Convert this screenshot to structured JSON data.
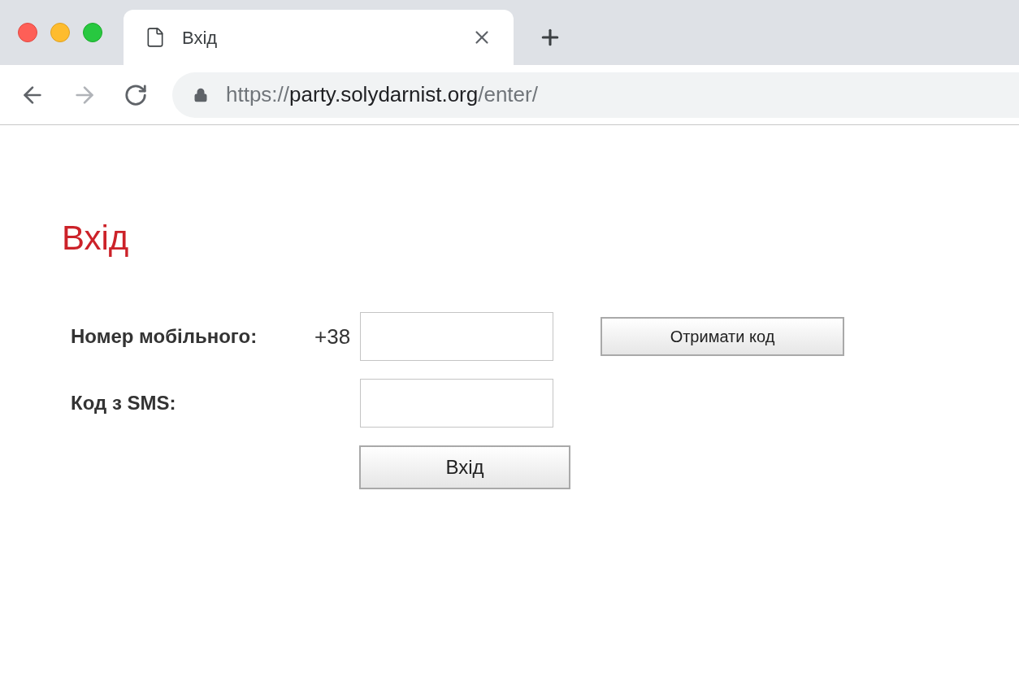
{
  "tab": {
    "title": "Вхід",
    "selected": true
  },
  "toolbar": {
    "back": {
      "disabled": false
    },
    "forward": {
      "disabled": true
    }
  },
  "address_bar": {
    "scheme": "https://",
    "host": "party.solydarnist.org",
    "path": "/enter/"
  },
  "page": {
    "heading": "Вхід",
    "phone_label": "Номер мобільного:",
    "phone_prefix": "+38",
    "get_code_button": "Отримати код",
    "code_label": "Код з SMS:",
    "submit_button": "Вхід"
  }
}
